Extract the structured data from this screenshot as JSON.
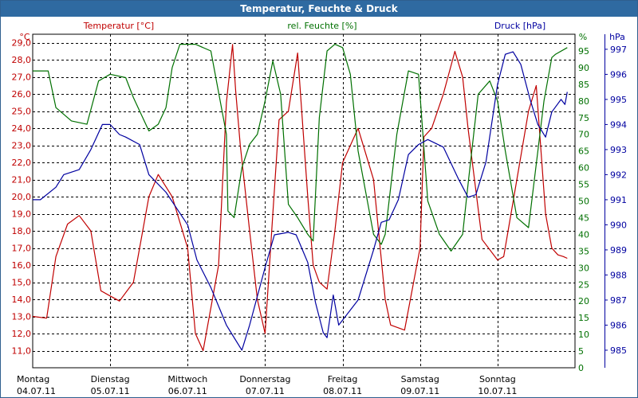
{
  "window_title": "Temperatur, Feuchte & Druck",
  "colors": {
    "temperature": "#c00000",
    "humidity": "#007000",
    "pressure": "#0000a0",
    "grid": "#000000",
    "titlebar": "#2f6aa1"
  },
  "chart_data": {
    "type": "line",
    "title": "Temperatur, Feuchte & Druck",
    "grid": true,
    "axes": {
      "left": {
        "label": "Temperatur [°C]",
        "unit": "°C",
        "range": [
          10.0,
          29.5
        ],
        "ticks": [
          "29,0",
          "28,0",
          "27,0",
          "26,0",
          "25,0",
          "24,0",
          "23,0",
          "22,0",
          "21,0",
          "20,0",
          "19,0",
          "18,0",
          "17,0",
          "16,0",
          "15,0",
          "14,0",
          "13,0",
          "12,0",
          "11,0"
        ]
      },
      "mid": {
        "label": "rel. Feuchte [%]",
        "unit": "%",
        "range": [
          0,
          100
        ],
        "ticks": [
          "95",
          "90",
          "85",
          "80",
          "75",
          "70",
          "65",
          "60",
          "55",
          "50",
          "45",
          "40",
          "35",
          "30",
          "25",
          "20",
          "15",
          "10",
          "5",
          "0"
        ]
      },
      "right": {
        "label": "Druck [hPa]",
        "unit": "hPa",
        "range": [
          984.3,
          997.6
        ],
        "ticks": [
          "997",
          "996",
          "995",
          "994",
          "993",
          "992",
          "991",
          "990",
          "989",
          "988",
          "987",
          "986",
          "985"
        ]
      },
      "x": {
        "range": [
          0,
          7
        ],
        "unit": "days",
        "ticks": [
          {
            "day": "Montag",
            "date": "04.07.11"
          },
          {
            "day": "Dienstag",
            "date": "05.07.11"
          },
          {
            "day": "Mittwoch",
            "date": "06.07.11"
          },
          {
            "day": "Donnerstag",
            "date": "07.07.11"
          },
          {
            "day": "Freitag",
            "date": "08.07.11"
          },
          {
            "day": "Samstag",
            "date": "09.07.11"
          },
          {
            "day": "Sonntag",
            "date": "10.07.11"
          }
        ]
      }
    },
    "series": [
      {
        "name": "Temperatur [°C]",
        "axis": "left",
        "x": [
          0.0,
          0.18,
          0.3,
          0.45,
          0.6,
          0.75,
          0.88,
          1.0,
          1.12,
          1.3,
          1.5,
          1.62,
          1.8,
          2.0,
          2.1,
          2.2,
          2.4,
          2.5,
          2.58,
          2.62,
          2.68,
          2.8,
          2.9,
          3.0,
          3.1,
          3.18,
          3.3,
          3.42,
          3.55,
          3.62,
          3.7,
          3.8,
          3.9,
          4.0,
          4.2,
          4.4,
          4.55,
          4.62,
          4.8,
          5.0,
          5.05,
          5.15,
          5.3,
          5.45,
          5.55,
          5.62,
          5.8,
          6.0,
          6.08,
          6.25,
          6.4,
          6.5,
          6.62,
          6.7,
          6.78,
          6.85,
          6.9
        ],
        "values": [
          13.0,
          12.9,
          16.5,
          18.4,
          18.9,
          18.0,
          14.5,
          14.2,
          13.9,
          15.0,
          20.0,
          21.3,
          20.0,
          17.0,
          12.0,
          11.0,
          16.0,
          25.5,
          28.9,
          26.2,
          23.0,
          18.0,
          14.0,
          12.0,
          19.0,
          24.5,
          25.0,
          28.4,
          20.0,
          16.0,
          15.0,
          14.6,
          18.0,
          22.0,
          24.0,
          21.0,
          14.0,
          12.5,
          12.2,
          17.0,
          23.5,
          24.0,
          26.0,
          28.5,
          27.0,
          24.0,
          17.5,
          16.3,
          16.5,
          21.0,
          25.0,
          26.5,
          19.0,
          17.0,
          16.6,
          16.5,
          16.4
        ]
      },
      {
        "name": "rel. Feuchte [%]",
        "axis": "mid",
        "x": [
          0.0,
          0.2,
          0.3,
          0.5,
          0.7,
          0.85,
          1.0,
          1.2,
          1.3,
          1.5,
          1.62,
          1.72,
          1.8,
          1.9,
          2.1,
          2.3,
          2.5,
          2.52,
          2.6,
          2.7,
          2.8,
          2.9,
          3.0,
          3.1,
          3.2,
          3.3,
          3.42,
          3.55,
          3.62,
          3.7,
          3.8,
          3.9,
          4.0,
          4.1,
          4.2,
          4.4,
          4.5,
          4.55,
          4.7,
          4.85,
          4.98,
          5.1,
          5.25,
          5.4,
          5.55,
          5.62,
          5.75,
          5.9,
          6.0,
          6.1,
          6.25,
          6.4,
          6.6,
          6.7,
          6.75,
          6.9
        ],
        "values": [
          89.0,
          89.0,
          78.0,
          74.0,
          73.0,
          86.0,
          88.0,
          87.0,
          81.0,
          71.0,
          73.0,
          78.0,
          90.0,
          97.0,
          97.0,
          95.0,
          70.0,
          47.0,
          45.0,
          60.0,
          67.0,
          70.0,
          80.0,
          92.0,
          82.0,
          49.0,
          45.0,
          40.0,
          38.0,
          75.0,
          95.0,
          97.0,
          96.0,
          88.0,
          65.0,
          40.0,
          37.0,
          40.0,
          70.0,
          89.0,
          88.0,
          50.0,
          40.0,
          35.0,
          40.0,
          55.0,
          82.0,
          86.0,
          80.0,
          65.0,
          45.0,
          42.0,
          80.0,
          93.0,
          94.0,
          96.0
        ]
      },
      {
        "name": "Druck [hPa]",
        "axis": "right",
        "x": [
          0.0,
          0.1,
          0.3,
          0.4,
          0.6,
          0.75,
          0.9,
          1.0,
          1.12,
          1.2,
          1.38,
          1.5,
          1.72,
          1.85,
          2.0,
          2.12,
          2.3,
          2.5,
          2.58,
          2.7,
          2.8,
          3.0,
          3.12,
          3.3,
          3.4,
          3.55,
          3.65,
          3.75,
          3.8,
          3.88,
          3.95,
          4.0,
          4.2,
          4.4,
          4.5,
          4.6,
          4.72,
          4.85,
          4.98,
          5.1,
          5.3,
          5.5,
          5.62,
          5.72,
          5.85,
          6.0,
          6.1,
          6.2,
          6.3,
          6.42,
          6.52,
          6.62,
          6.7,
          6.82,
          6.87,
          6.9
        ],
        "values": [
          991.0,
          991.0,
          991.5,
          992.0,
          992.2,
          993.0,
          994.0,
          994.0,
          993.6,
          993.5,
          993.2,
          992.0,
          991.3,
          990.7,
          990.0,
          988.6,
          987.5,
          986.0,
          985.6,
          985.0,
          986.0,
          988.3,
          989.6,
          989.7,
          989.6,
          988.5,
          986.9,
          985.7,
          985.5,
          987.2,
          986.0,
          986.2,
          987.0,
          989.0,
          990.1,
          990.2,
          991.0,
          992.8,
          993.2,
          993.4,
          993.1,
          991.8,
          991.1,
          991.2,
          992.5,
          995.6,
          996.8,
          996.9,
          996.4,
          995.0,
          994.0,
          993.5,
          994.5,
          995.0,
          994.8,
          995.3
        ]
      }
    ]
  }
}
